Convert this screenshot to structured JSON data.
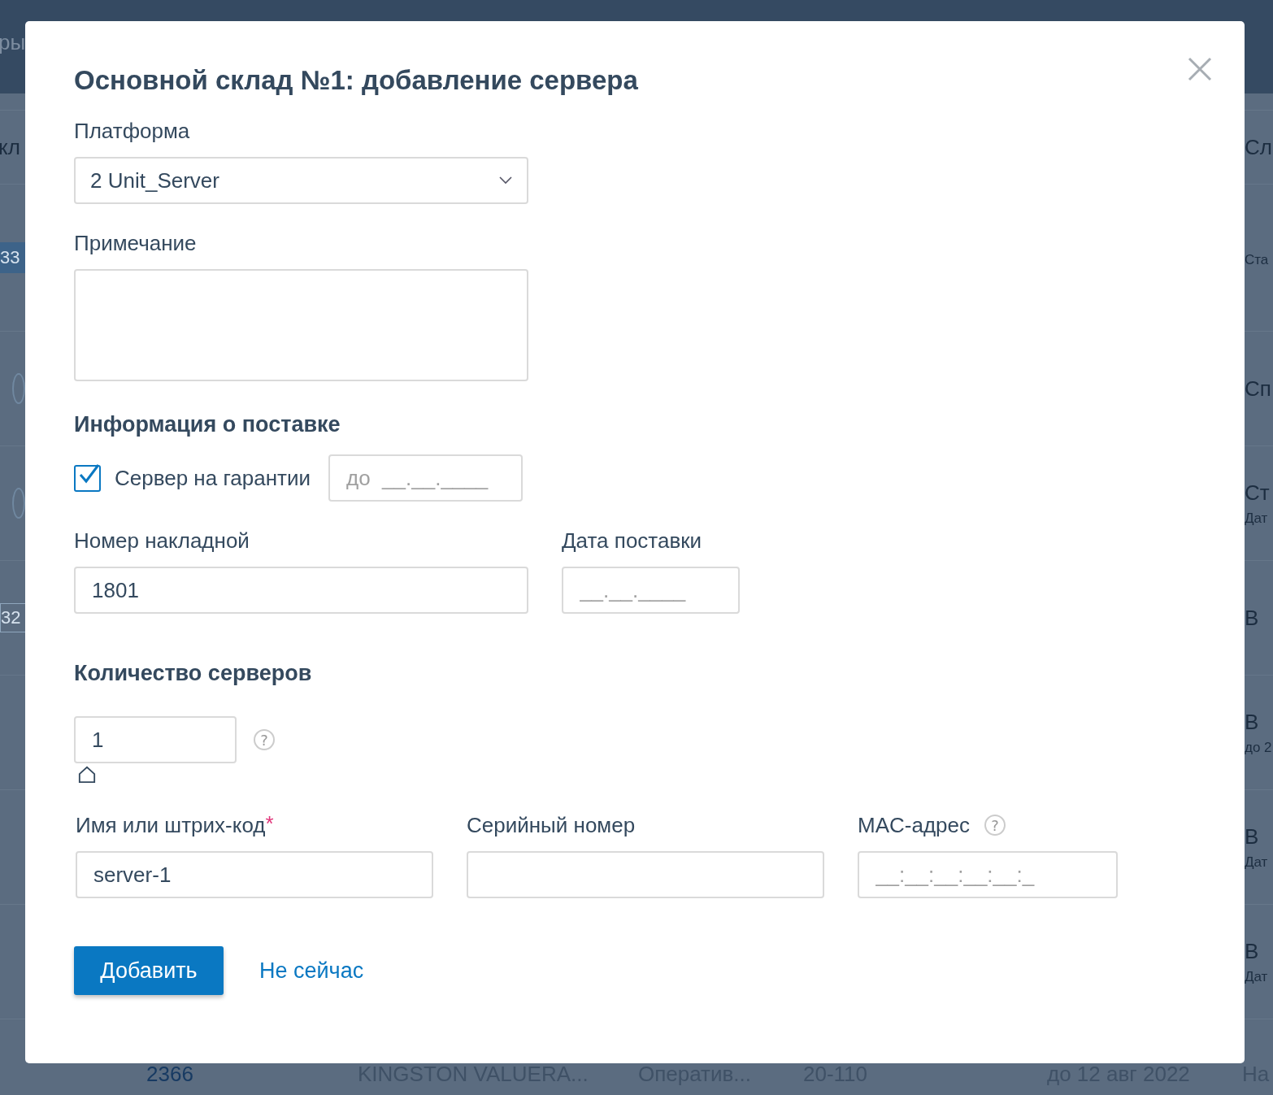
{
  "background": {
    "header_text": "ры",
    "rows": [
      {
        "left": {
          "kind": "text",
          "text": "кл"
        },
        "right": "Сл"
      },
      {
        "left": {
          "kind": "badge",
          "text": "33"
        },
        "right_sub": "Ста"
      },
      {
        "left": {
          "kind": "circle"
        },
        "right": "Сп"
      },
      {
        "left": {
          "kind": "circle"
        },
        "right": "Ст",
        "right_sub": "Дат"
      },
      {
        "left": {
          "kind": "outlined",
          "text": "32"
        },
        "right": "В"
      },
      {
        "right": "В",
        "right_sub": "до 2"
      },
      {
        "right": "В",
        "right_sub": "Дат"
      },
      {
        "right": "В",
        "right_sub": "Дат"
      }
    ],
    "bottom_row": [
      "2366",
      "KINGSTON VALUERA...",
      "Оператив...",
      "20-110",
      "до 12 авг 2022",
      "На"
    ]
  },
  "dialog": {
    "title": "Основной склад №1: добавление сервера",
    "platform": {
      "label": "Платформа",
      "value": "2 Unit_Server"
    },
    "note": {
      "label": "Примечание"
    },
    "delivery_heading": "Информация о поставке",
    "warranty": {
      "label": "Сервер на гарантии",
      "checked": true,
      "placeholder": "до  __.__.____"
    },
    "invoice": {
      "label": "Номер накладной",
      "value": "1801"
    },
    "delivery_date": {
      "label": "Дата поставки",
      "placeholder": "__.__.____"
    },
    "quantity_heading": "Количество серверов",
    "quantity": {
      "value": "1",
      "help": "?"
    },
    "fields": [
      {
        "label": "Имя или штрих-код",
        "required_mark": "*",
        "value": "server-1"
      },
      {
        "label": "Серийный номер"
      },
      {
        "label": "MAC-адрес",
        "help": "?",
        "placeholder": "__:__:__:__:__:_"
      }
    ],
    "primary_button": "Добавить",
    "cancel_link": "Не сейчас"
  }
}
